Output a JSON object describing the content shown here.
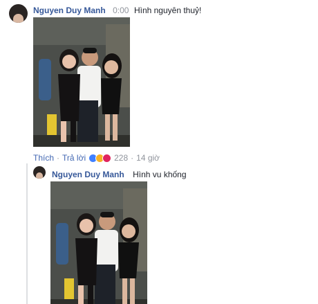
{
  "comment": {
    "author": "Nguyen Duy Manh",
    "timestamp": "0:00",
    "text": "Hình nguyên thuỷ!",
    "actions": {
      "like": "Thích",
      "reply": "Trả lời",
      "reaction_count": "228",
      "age": "14 giờ"
    },
    "reaction_icons": [
      "like-reaction-icon",
      "haha-reaction-icon",
      "love-reaction-icon"
    ],
    "reaction_colors": [
      "#4080ff",
      "#f7b125",
      "#e0245e"
    ]
  },
  "reply": {
    "author": "Nguyen Duy Manh",
    "text": "Hình vu khống"
  },
  "colors": {
    "name": "#365899",
    "link": "#4267b2",
    "meta": "#90949c"
  }
}
